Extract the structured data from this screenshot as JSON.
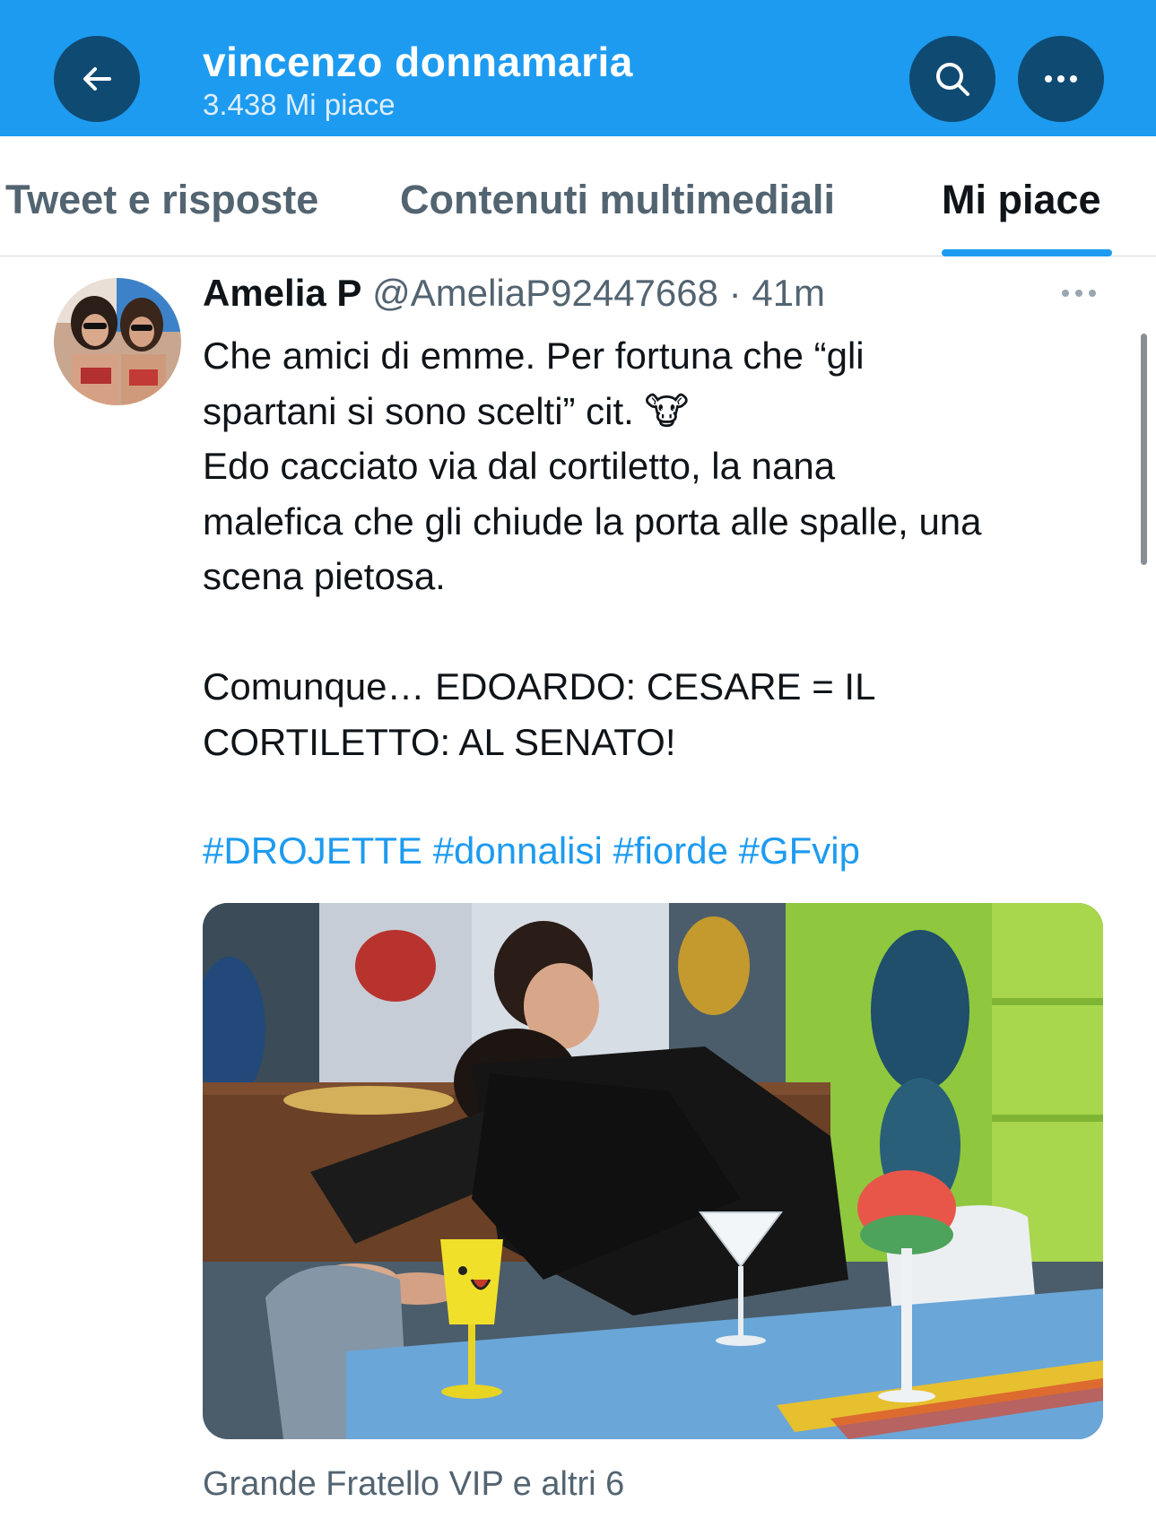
{
  "header": {
    "title": "vincenzo donnamaria",
    "subtitle": "3.438 Mi piace",
    "back_icon": "arrow-left-icon",
    "search_icon": "search-icon",
    "more_icon": "more-horizontal-icon",
    "accent_color": "#1d9bf0"
  },
  "tabs": [
    {
      "label": "Tweet e risposte",
      "active": false
    },
    {
      "label": "Contenuti multimediali",
      "active": false
    },
    {
      "label": "Mi piace",
      "active": true
    }
  ],
  "tweet": {
    "author_name": "Amelia P",
    "author_handle": "@AmeliaP92447668",
    "separator": "·",
    "time": "41m",
    "lines": [
      "Che amici di emme. Per fortuna che “gli",
      "spartani si sono scelti” cit. 🐮",
      "Edo cacciato via dal cortiletto, la nana",
      "malefica che gli chiude la porta alle spalle, una",
      "scena pietosa.",
      "",
      "Comunque… EDOARDO: CESARE = IL",
      "CORTILETTO: AL SENATO!"
    ],
    "hashtags": [
      "#DROJETTE",
      "#donnalisi",
      "#fiorde",
      "#GFvip"
    ],
    "social_context": "Grande Fratello VIP e altri 6"
  }
}
